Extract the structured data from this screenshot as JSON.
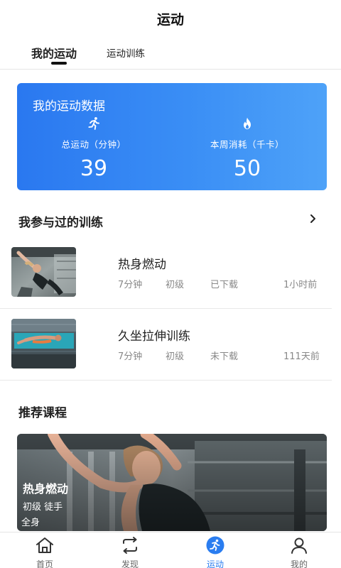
{
  "header": {
    "title": "运动"
  },
  "tabs": [
    {
      "label": "我的运动",
      "active": true
    },
    {
      "label": "运动训练",
      "active": false
    }
  ],
  "stats": {
    "title": "我的运动数据",
    "total": {
      "label": "总运动（分钟）",
      "value": "39",
      "icon": "running-icon"
    },
    "week": {
      "label": "本周消耗（千卡）",
      "value": "50",
      "icon": "flame-icon"
    }
  },
  "trained_section": {
    "title": "我参与过的训练",
    "more_icon": "chevron-right-icon"
  },
  "trainings": [
    {
      "name": "热身燃动",
      "duration": "7分钟",
      "level": "初级",
      "status": "已下载",
      "time": "1小时前"
    },
    {
      "name": "久坐拉伸训练",
      "duration": "7分钟",
      "level": "初级",
      "status": "未下载",
      "time": "111天前"
    }
  ],
  "recommend": {
    "title": "推荐课程",
    "course": {
      "name": "热身燃动",
      "level": "初级 徒手",
      "part": "全身"
    }
  },
  "nav": [
    {
      "label": "首页",
      "icon": "home-icon",
      "active": false
    },
    {
      "label": "发现",
      "icon": "discover-icon",
      "active": false
    },
    {
      "label": "运动",
      "icon": "sport-icon",
      "active": true
    },
    {
      "label": "我的",
      "icon": "profile-icon",
      "active": false
    }
  ],
  "colors": {
    "accent": "#2a7df0",
    "card_gradient_start": "#2a78f0",
    "card_gradient_end": "#4ea2f8"
  }
}
